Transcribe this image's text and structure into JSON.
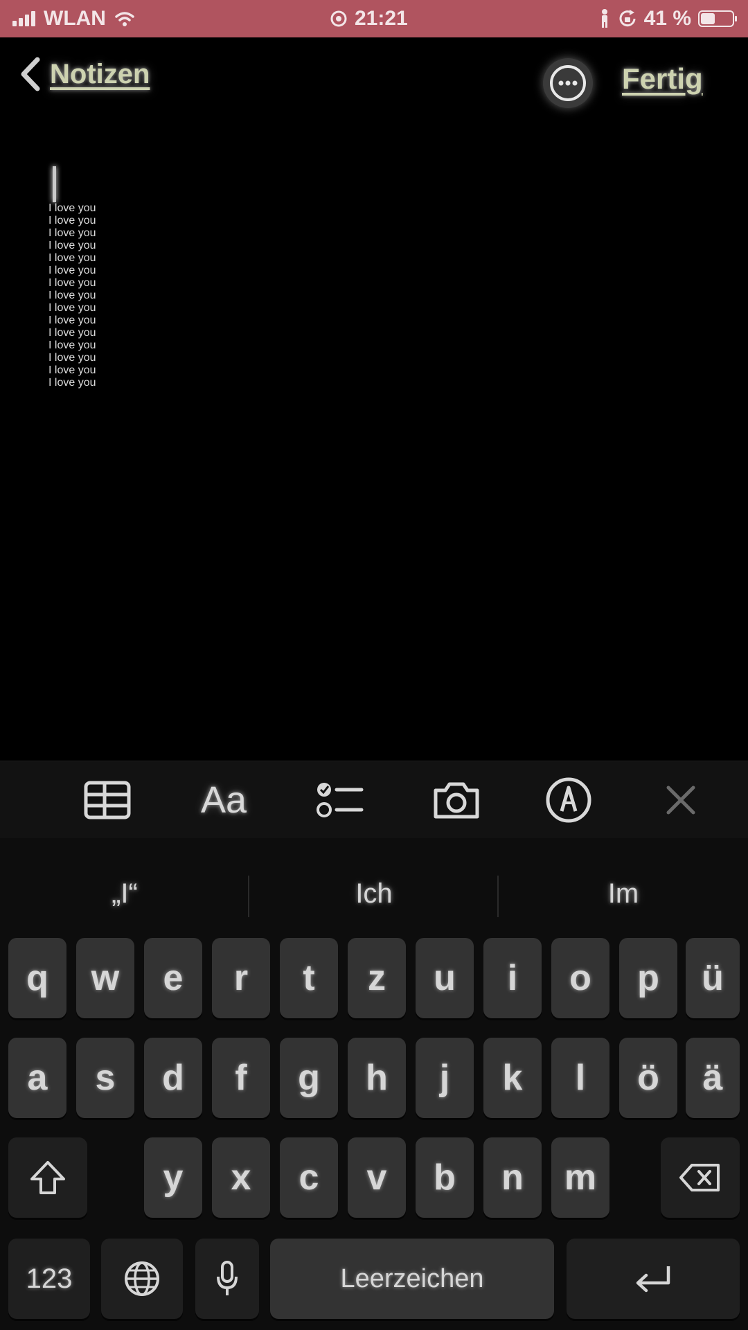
{
  "status_bar": {
    "carrier": "WLAN",
    "time": "21:21",
    "battery_percent": "41 %",
    "battery_level": 0.41,
    "icons": [
      "signal-icon",
      "wifi-icon",
      "location-icon",
      "person-icon",
      "rotation-lock-icon",
      "battery-icon"
    ]
  },
  "nav": {
    "back_label": "Notizen",
    "done_label": "Fertig"
  },
  "note": {
    "lines": [
      "I love you",
      "I love you",
      "I love you",
      "I love you",
      "I love you",
      "I love you",
      "I love you",
      "I love you",
      "I love you",
      "I love you",
      "I love you",
      "I love you",
      "I love you",
      "I love you",
      "I love you"
    ]
  },
  "toolbar": {
    "format_label": "Aa",
    "icons": [
      "table-icon",
      "format-icon",
      "checklist-icon",
      "camera-icon",
      "markup-icon",
      "close-icon"
    ]
  },
  "suggestions": [
    "„I“",
    "Ich",
    "Im"
  ],
  "keyboard": {
    "row1": [
      "q",
      "w",
      "e",
      "r",
      "t",
      "z",
      "u",
      "i",
      "o",
      "p",
      "ü"
    ],
    "row2": [
      "a",
      "s",
      "d",
      "f",
      "g",
      "h",
      "j",
      "k",
      "l",
      "ö",
      "ä"
    ],
    "row3": [
      "y",
      "x",
      "c",
      "v",
      "b",
      "n",
      "m"
    ],
    "numbers_label": "123",
    "space_label": "Leerzeichen"
  }
}
